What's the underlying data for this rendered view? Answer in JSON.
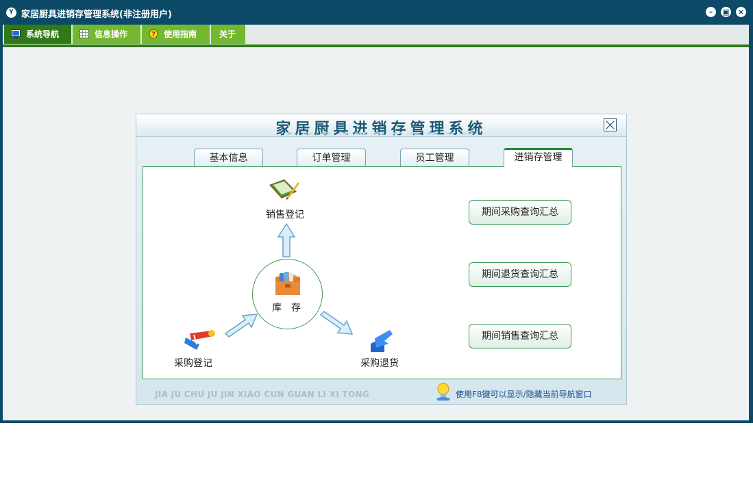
{
  "window": {
    "title": "家居厨具进销存管理系统(非注册用户)",
    "logo_text": "Y",
    "minimize_glyph": "–",
    "restore_glyph": "▣",
    "close_glyph": "×"
  },
  "menu": {
    "items": [
      {
        "label": "系统导航",
        "icon": "monitor-icon",
        "active": true
      },
      {
        "label": "信息操作",
        "icon": "grid-icon",
        "active": false
      },
      {
        "label": "使用指南",
        "icon": "help-icon",
        "active": false
      },
      {
        "label": "关于",
        "icon": "",
        "active": false
      }
    ]
  },
  "panel": {
    "title": "家居厨具进销存管理系统",
    "tabs": [
      "基本信息",
      "订单管理",
      "员工管理",
      "进销存管理"
    ],
    "active_tab": "进销存管理",
    "nodes": {
      "sales": "销售登记",
      "inventory": "库　存",
      "purchase": "采购登记",
      "purchase_return": "采购退货"
    },
    "queries": [
      "期间采购查询汇总",
      "期间退货查询汇总",
      "期间销售查询汇总"
    ],
    "footer_pinyin": "JIA JU CHU JU JIN XIAO CUN GUAN LI XI TONG",
    "hint": "使用F8键可以显示/隐藏当前导航窗口"
  },
  "colors": {
    "title_bar": "#0d4a67",
    "menu_green": "#74b830",
    "menu_active": "#2f7a16",
    "border_green": "#3a9a56",
    "panel_title": "#1a5a74"
  }
}
